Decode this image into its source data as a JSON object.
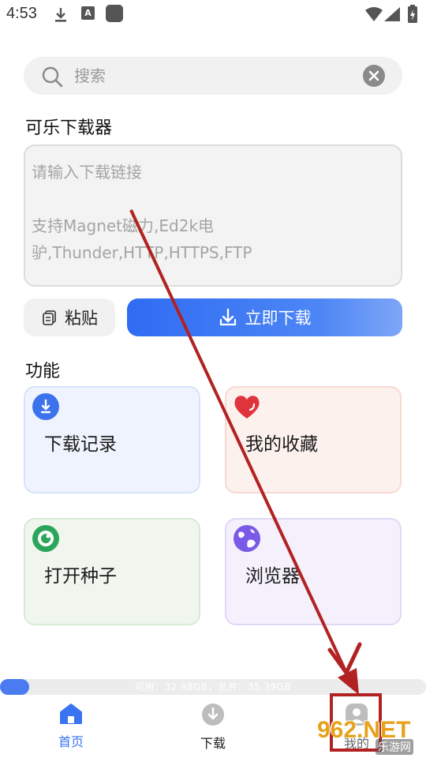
{
  "status_bar": {
    "time": "4:53",
    "icons": [
      "download-icon",
      "a-icon",
      "square-icon",
      "wifi-icon",
      "signal-icon",
      "battery-icon"
    ],
    "a_glyph": "A"
  },
  "search": {
    "placeholder": "搜索",
    "icon": "search-icon",
    "clear_icon": "close-icon"
  },
  "app_title": "可乐下载器",
  "link_input": {
    "placeholder": "请输入下载链接\n\n支持Magnet磁力,Ed2k电驴,Thunder,HTTP,HTTPS,FTP"
  },
  "buttons": {
    "paste": "粘贴",
    "download_now": "立即下载"
  },
  "features_title": "功能",
  "features": [
    {
      "label": "下载记录",
      "icon": "download-icon",
      "bg": "#eef3fd"
    },
    {
      "label": "我的收藏",
      "icon": "heart-icon",
      "bg": "#fdf1ee"
    },
    {
      "label": "打开种子",
      "icon": "eye-icon",
      "bg": "#f0f6ee"
    },
    {
      "label": "浏览器",
      "icon": "globe-icon",
      "bg": "#f4f0fc"
    }
  ],
  "storage": {
    "text": "可用：32.98GB，总共：35.39GB",
    "used_fraction": 0.068
  },
  "bottom_nav": [
    {
      "label": "首页",
      "icon": "home-icon",
      "active": true
    },
    {
      "label": "下载",
      "icon": "download-circle-icon",
      "active": false
    },
    {
      "label": "我的",
      "icon": "user-icon",
      "active": false
    }
  ],
  "watermark": {
    "main": "962.NET",
    "sub": "乐游网"
  },
  "colors": {
    "accent": "#3a74f2",
    "annotation": "#b22222"
  }
}
